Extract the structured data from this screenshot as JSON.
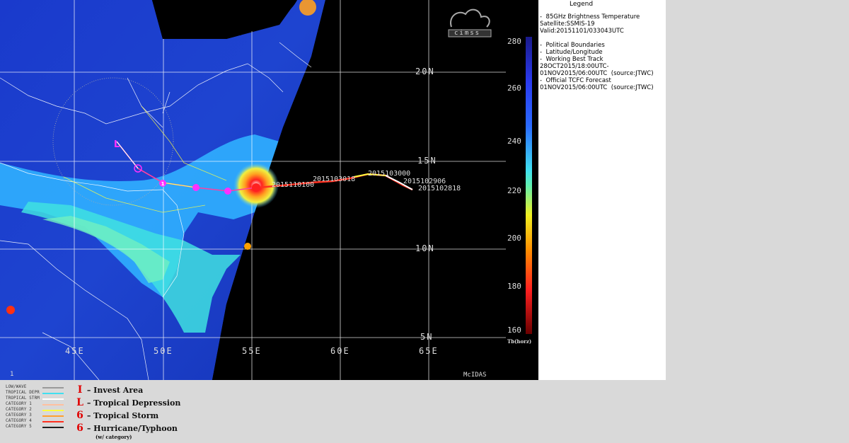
{
  "map": {
    "lat_labels": [
      "20N",
      "15N",
      "10N",
      "5N"
    ],
    "lon_labels": [
      "45E",
      "50E",
      "55E",
      "60E",
      "65E"
    ],
    "corner_left_label": "1",
    "corner_right_label": "McIDAS",
    "logo_text": "cimss",
    "track_dates": [
      "2015110100",
      "2015103018",
      "2015103000",
      "2015102906",
      "2015102818"
    ],
    "storm_symbols": [
      "L",
      "6",
      "1",
      "6",
      "6"
    ]
  },
  "colorbar": {
    "ticks": [
      "280",
      "260",
      "240",
      "220",
      "200",
      "180",
      "160"
    ],
    "unit_label": "Tb(horz)",
    "colors": {
      "top": "#1a1a8a",
      "mid_blue": "#2a6aff",
      "cyan": "#40e0f0",
      "yellow": "#f0f020",
      "orange": "#ff8c00",
      "red": "#d00000",
      "bottom": "#6a0000"
    }
  },
  "legend": {
    "title": "Legend",
    "lines": [
      "-  85GHz Brightness Temperature",
      "Satellite:SSMIS-19",
      "Valid:20151101/033043UTC",
      "",
      "-  Political Boundaries",
      "-  Latitude/Longitude",
      "-  Working Best Track",
      "28OCT2015/18:00UTC-",
      "01NOV2015/06:00UTC  (source:JTWC)",
      "-  Official TCFC Forecast",
      "01NOV2015/06:00UTC  (source:JTWC)"
    ]
  },
  "track_legend": {
    "items": [
      {
        "label": "LOW/WAVE",
        "color": "#9a9a9a"
      },
      {
        "label": "TROPICAL DEPR",
        "color": "#40e0f0"
      },
      {
        "label": "TROPICAL STRM",
        "color": "#ffffff"
      },
      {
        "label": "CATEGORY 1",
        "color": "#ffc0a0"
      },
      {
        "label": "CATEGORY 2",
        "color": "#ffff40"
      },
      {
        "label": "CATEGORY 3",
        "color": "#ffa030"
      },
      {
        "label": "CATEGORY 4",
        "color": "#ff3020"
      },
      {
        "label": "CATEGORY 5",
        "color": "#202020"
      }
    ]
  },
  "symbol_legend": {
    "items": [
      {
        "glyph": "I",
        "label": "– Invest Area"
      },
      {
        "glyph": "L",
        "label": "– Tropical Depression"
      },
      {
        "glyph": "6",
        "label": "– Tropical Storm"
      },
      {
        "glyph": "6",
        "label": "– Hurricane/Typhoon"
      }
    ],
    "note": "(w/ category)"
  }
}
